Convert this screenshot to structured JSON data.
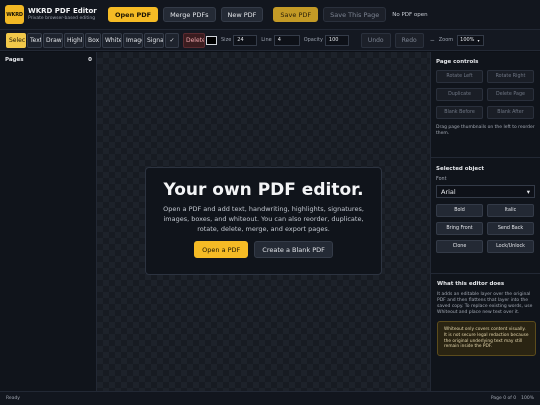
{
  "app": {
    "logo": "WKRD",
    "title": "WKRD PDF Editor",
    "subtitle": "Private browser-based editing"
  },
  "header": {
    "open_pdf": "Open PDF",
    "merge_pdfs": "Merge PDFs",
    "new_pdf": "New PDF",
    "save_pdf": "Save PDF",
    "save_this_page": "Save This Page",
    "status": "No PDF open"
  },
  "toolbar": {
    "tools": [
      "Select",
      "Text",
      "Draw",
      "Highlight",
      "Box",
      "Whiteout",
      "Image",
      "Signature",
      "✓"
    ],
    "delete_object": "Delete Object",
    "size_label": "Size",
    "size_value": "24",
    "line_label": "Line",
    "line_value": "4",
    "opacity_label": "Opacity",
    "opacity_value": "100",
    "undo": "Undo",
    "redo": "Redo",
    "zoom_out_icon": "−",
    "zoom_label": "Zoom",
    "zoom_value": "100%",
    "colors": {
      "accent": "#f5bb25",
      "text_color": "#000000"
    }
  },
  "left_panel": {
    "title": "Pages",
    "count": "0"
  },
  "welcome": {
    "title": "Your own PDF editor.",
    "text": "Open a PDF and add text, handwriting, highlights, signatures, images, boxes, and whiteout. You can also reorder, duplicate, rotate, delete, merge, and export pages.",
    "open_button": "Open a PDF",
    "blank_button": "Create a Blank PDF"
  },
  "page_controls": {
    "title": "Page controls",
    "buttons": [
      "Rotate Left",
      "Rotate Right",
      "Duplicate",
      "Delete Page",
      "Blank Before",
      "Blank After"
    ],
    "note": "Drag page thumbnails on the left to reorder them."
  },
  "selected_object": {
    "title": "Selected object",
    "font_label": "Font",
    "font_value": "Arial",
    "buttons": [
      "Bold",
      "Italic",
      "Bring Front",
      "Send Back",
      "Clone",
      "Lock/Unlock"
    ]
  },
  "about": {
    "title": "What this editor does",
    "text": "It adds an editable layer over the original PDF and then flattens that layer into the saved copy. To replace existing words, use Whiteout and place new text over it.",
    "warning": "Whiteout only covers content visually. It is not secure legal redaction because the original underlying text may still remain inside the PDF."
  },
  "footer": {
    "status": "Ready",
    "page_info": "Page 0 of 0",
    "zoom": "100%"
  }
}
